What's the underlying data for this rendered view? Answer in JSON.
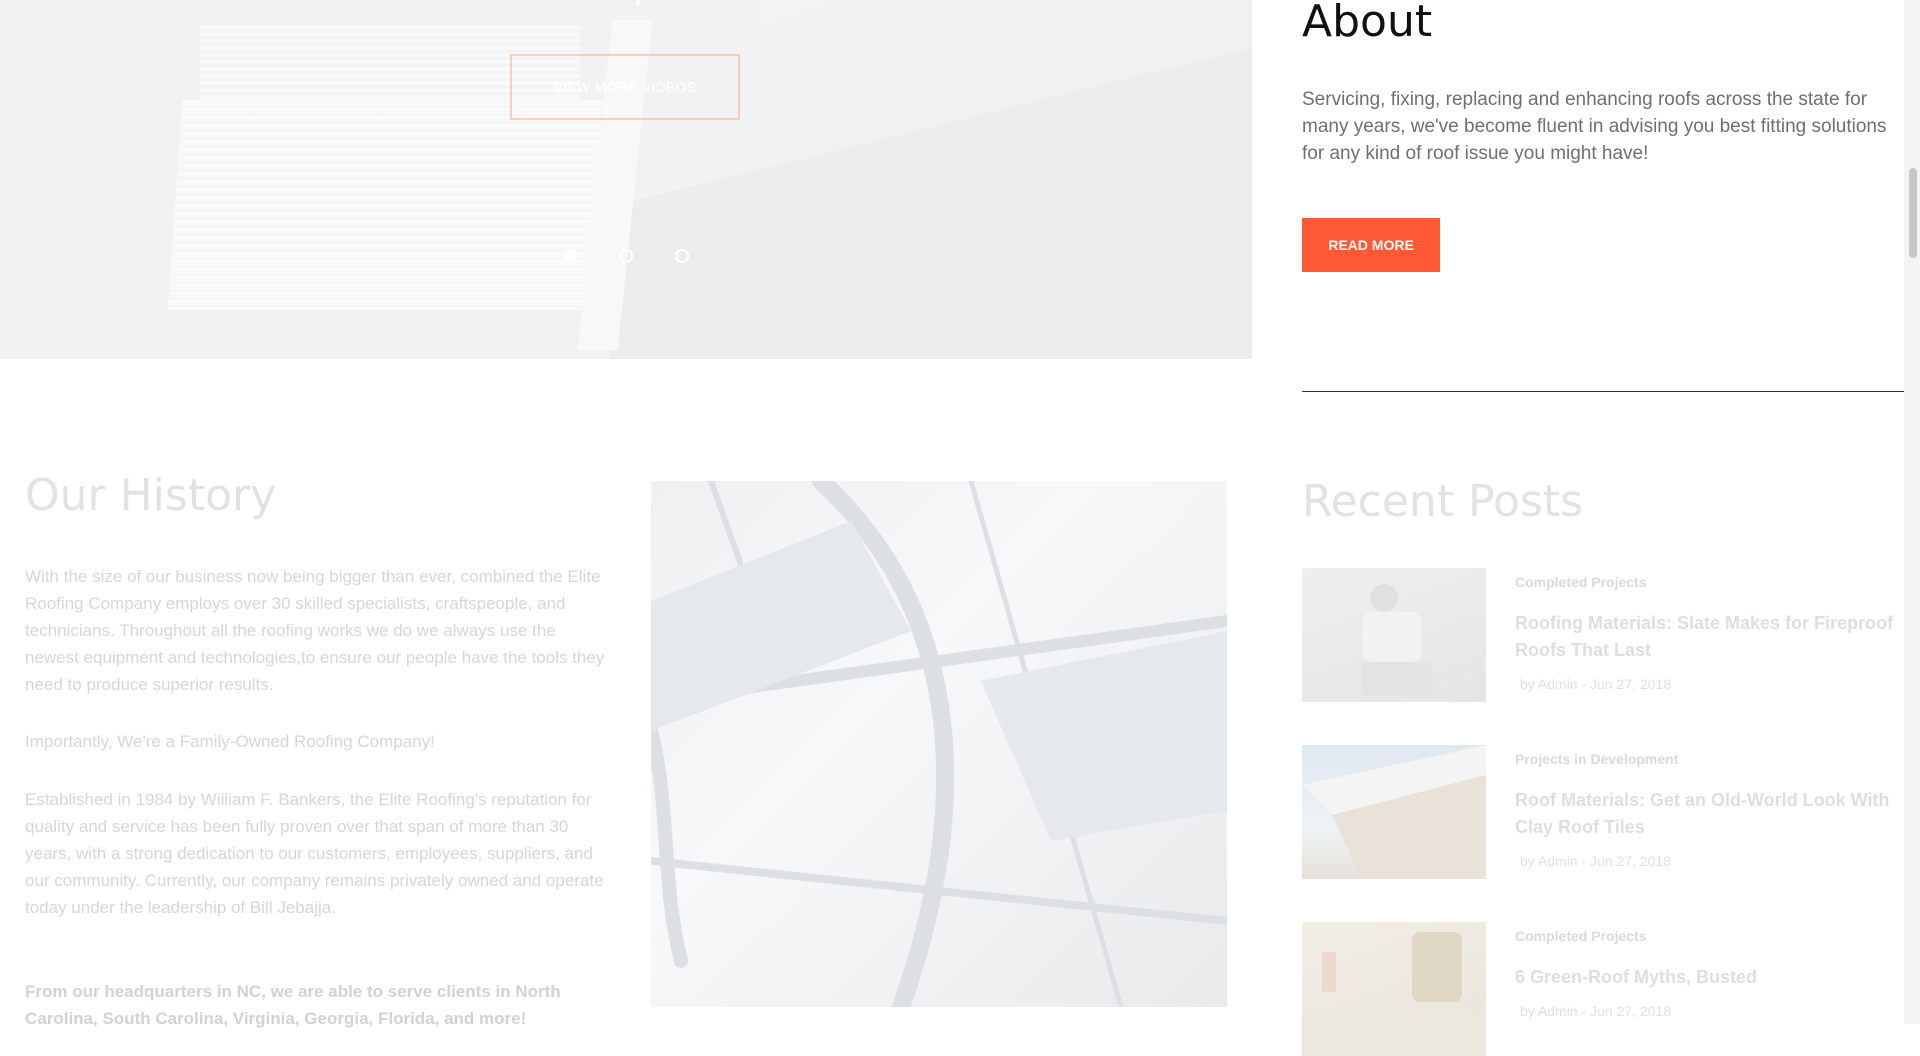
{
  "hero": {
    "view_more_label": "VIEW MORE VIDEOS",
    "slides": 3,
    "active_slide": 1
  },
  "about": {
    "title": "About",
    "text": "Servicing, fixing, replacing and enhancing roofs across the state for many years, we've become fluent in advising you best fitting solutions for any kind of roof issue you might have!",
    "button_label": "READ MORE"
  },
  "history": {
    "title": "Our History",
    "p1": "With the size of our business now being bigger than ever, combined the Elite Roofing Company employs over 30 skilled specialists, craftspeople, and technicians. Throughout all the roofing works we do we always use the newest equipment and technologies,to ensure our people have the tools they need to produce superior results.",
    "p2": "Importantly, We're a Family-Owned Roofing Company!",
    "p3": "Established in 1984 by William F. Bankers, the Elite Roofing's reputation for quality and service has been fully proven over that span of more than 30 years, with a strong dedication to our customers, employees, suppliers, and our community. Currently, our company remains privately owned and operate today under the leadership of Bill Jebajja.",
    "p4": "From our headquarters in NC, we are able to serve clients in North Carolina, South Carolina, Virginia, Georgia, Florida, and more!"
  },
  "recent": {
    "title": "Recent Posts",
    "posts": [
      {
        "category": "Completed Projects",
        "title": "Roofing Materials: Slate Makes for Fireproof Roofs That Last",
        "meta": "by Admin - Jun 27, 2018"
      },
      {
        "category": "Projects in Development",
        "title": "Roof Materials: Get an Old-World Look With Clay Roof Tiles",
        "meta": "by Admin - Jun 27, 2018"
      },
      {
        "category": "Completed Projects",
        "title": "6 Green-Roof Myths, Busted",
        "meta": "by Admin - Jun 27, 2018"
      }
    ]
  },
  "colors": {
    "accent": "#ff5a35",
    "heading_dark": "#111111",
    "faded_text": "#d6d6d6"
  }
}
